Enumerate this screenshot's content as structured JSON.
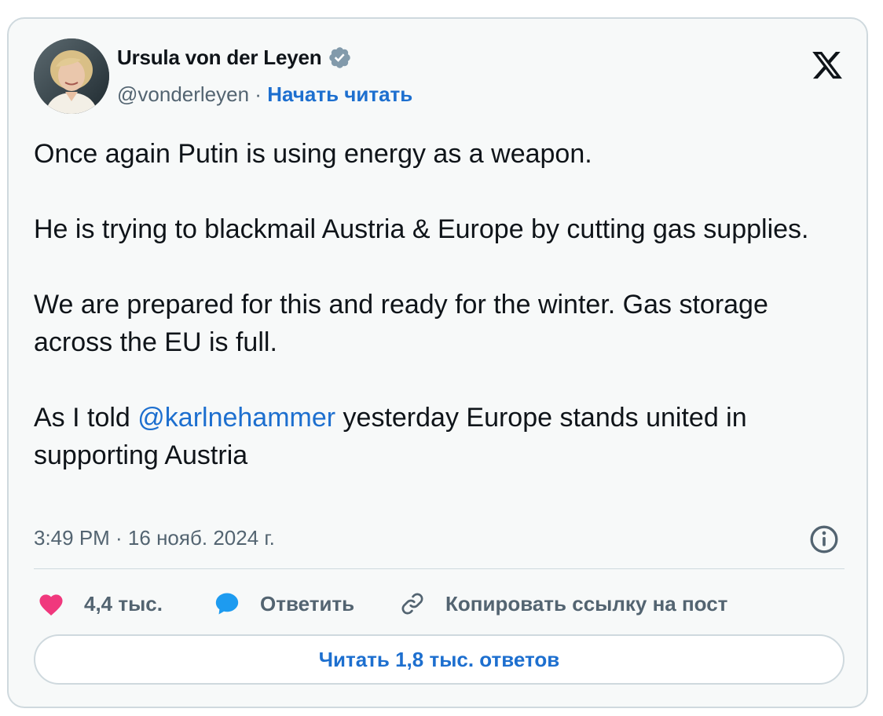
{
  "author": {
    "name": "Ursula von der Leyen",
    "handle": "@vonderleyen",
    "separator": "·",
    "follow_label": "Начать читать",
    "verified_icon": "verified-badge-icon"
  },
  "brand": {
    "logo_icon": "x-logo-icon"
  },
  "tweet": {
    "paragraph_1": "Once again Putin is using energy as a weapon.",
    "paragraph_2": "He is trying to blackmail Austria & Europe by cutting gas supplies.",
    "paragraph_3": "We are prepared for this and ready for the winter. Gas storage across the EU is full.",
    "paragraph_4_before": "As I told ",
    "paragraph_4_mention": "@karlnehammer",
    "paragraph_4_after": " yesterday Europe stands united in supporting Austria"
  },
  "meta": {
    "timestamp": "3:49 PM · 16 нояб. 2024 г.",
    "info_icon": "info-icon"
  },
  "actions": {
    "like_count": "4,4 тыс.",
    "reply_label": "Ответить",
    "copy_link_label": "Копировать ссылку на пост"
  },
  "read_replies_label": "Читать 1,8 тыс. ответов",
  "colors": {
    "accent": "#1d6fcf",
    "like": "#f0387d",
    "reply_bubble": "#1d9bf0",
    "verified": "#829aab",
    "muted_text": "#536471",
    "card_background": "#f7f9f9",
    "border": "#cfd9de"
  }
}
